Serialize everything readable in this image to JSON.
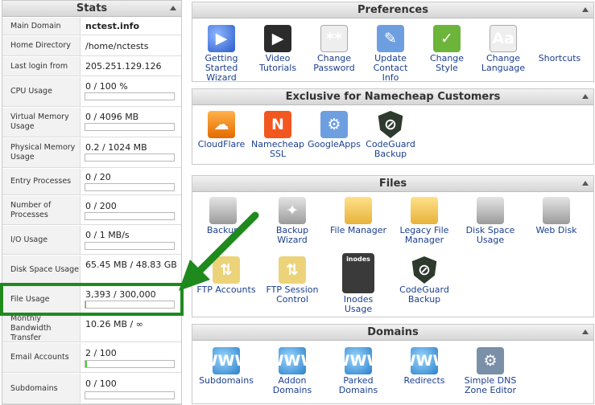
{
  "stats": {
    "title": "Stats",
    "rows": [
      {
        "label": "Main Domain",
        "value": "nctest.info"
      },
      {
        "label": "Home Directory",
        "value": "/home/nctests"
      },
      {
        "label": "Last login from",
        "value": "205.251.129.126"
      },
      {
        "label": "CPU Usage",
        "value": "0 / 100 %",
        "usage_pct": 0
      },
      {
        "label": "Virtual Memory Usage",
        "value": "0 / 4096 MB",
        "usage_pct": 0
      },
      {
        "label": "Physical Memory Usage",
        "value": "0.2 / 1024 MB",
        "usage_pct": 0
      },
      {
        "label": "Entry Processes",
        "value": "0 / 20",
        "usage_pct": 0
      },
      {
        "label": "Number of Processes",
        "value": "0 / 200",
        "usage_pct": 0
      },
      {
        "label": "I/O Usage",
        "value": "0 / 1 MB/s",
        "usage_pct": 0
      },
      {
        "label": "Disk Space Usage",
        "value": "65.45 MB / 48.83 GB"
      },
      {
        "label": "File Usage",
        "value": "3,393 / 300,000",
        "usage_pct": 1
      },
      {
        "label": "Monthly Bandwidth Transfer",
        "value": "10.26 MB / ∞"
      },
      {
        "label": "Email Accounts",
        "value": "2 / 100",
        "usage_pct": 2
      },
      {
        "label": "Subdomains",
        "value": "0 / 100",
        "usage_pct": 0
      }
    ]
  },
  "preferences": {
    "title": "Preferences",
    "items": [
      {
        "label": "Getting\nStarted\nWizard",
        "icon": "getting-started-icon"
      },
      {
        "label": "Video\nTutorials",
        "icon": "video-tutorials-icon"
      },
      {
        "label": "Change\nPassword",
        "icon": "lock-password-icon"
      },
      {
        "label": "Update\nContact\nInfo",
        "icon": "contact-info-icon"
      },
      {
        "label": "Change\nStyle",
        "icon": "style-icon"
      },
      {
        "label": "Change\nLanguage",
        "icon": "language-icon"
      },
      {
        "label": "Shortcuts",
        "icon": "star-icon"
      }
    ]
  },
  "exclusive": {
    "title": "Exclusive for Namecheap Customers",
    "items": [
      {
        "label": "CloudFlare",
        "icon": "cloudflare-icon"
      },
      {
        "label": "Namecheap\nSSL",
        "icon": "namecheap-ssl-icon"
      },
      {
        "label": "GoogleApps",
        "icon": "google-apps-icon"
      },
      {
        "label": "CodeGuard\nBackup",
        "icon": "codeguard-icon"
      }
    ]
  },
  "files": {
    "title": "Files",
    "items": [
      {
        "label": "Backup",
        "icon": "backup-drive-icon"
      },
      {
        "label": "Backup\nWizard",
        "icon": "backup-wizard-icon"
      },
      {
        "label": "File Manager",
        "icon": "file-manager-folder-icon"
      },
      {
        "label": "Legacy File\nManager",
        "icon": "legacy-folder-icon"
      },
      {
        "label": "Disk Space\nUsage",
        "icon": "disk-space-icon"
      },
      {
        "label": "Web Disk",
        "icon": "web-disk-icon"
      },
      {
        "label": "FTP Accounts",
        "icon": "ftp-accounts-icon"
      },
      {
        "label": "FTP Session\nControl",
        "icon": "ftp-session-icon"
      },
      {
        "label": "Inodes\nUsage",
        "icon": "inodes-calculator-icon",
        "badge": "inodes"
      },
      {
        "label": "CodeGuard\nBackup",
        "icon": "codeguard-icon"
      }
    ]
  },
  "domains": {
    "title": "Domains",
    "items": [
      {
        "label": "Subdomains",
        "icon": "subdomains-icon"
      },
      {
        "label": "Addon\nDomains",
        "icon": "addon-domains-icon"
      },
      {
        "label": "Parked\nDomains",
        "icon": "parked-domains-icon"
      },
      {
        "label": "Redirects",
        "icon": "redirects-icon"
      },
      {
        "label": "Simple DNS\nZone Editor",
        "icon": "dns-zone-editor-icon"
      }
    ]
  },
  "colors": {
    "highlight": "#1e8a1e",
    "usage_fill": "#4dcc3a",
    "link": "#1b3f8f"
  },
  "glyphs": {
    "www": "WWW"
  }
}
